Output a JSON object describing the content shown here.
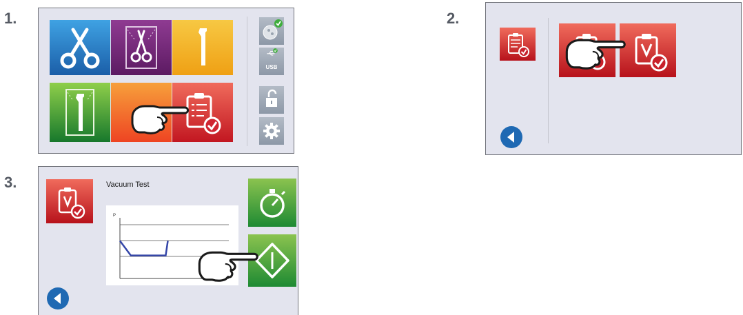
{
  "steps": {
    "step1": "1.",
    "step2": "2.",
    "step3": "3."
  },
  "screen1": {
    "tiles": [
      {
        "icon": "scissors-icon",
        "color": "#1b6fb8"
      },
      {
        "icon": "wrapped-forceps-icon",
        "color": "#7a2c7f"
      },
      {
        "icon": "handpiece-icon",
        "color": "#f1ad16"
      },
      {
        "icon": "wrapped-handpiece-icon",
        "color": "#3f9a3a"
      },
      {
        "icon": "orange-program-tile",
        "color": "#f05a28"
      },
      {
        "icon": "test-checklist-icon",
        "color": "#d7222d"
      }
    ],
    "side": {
      "sd_card_icon": "sd-card-check-icon",
      "usb_label": "USB",
      "lock_icon": "unlock-icon",
      "settings_icon": "gear-icon"
    }
  },
  "screen2": {
    "tests_icon": "test-checklist-icon",
    "options": [
      "bowie-dick-test-icon",
      "vacuum-test-icon"
    ]
  },
  "screen3": {
    "title": "Vacuum Test",
    "chart_ylabel": "P"
  },
  "colors": {
    "red_top": "#f06b5c",
    "red_bottom": "#b7121b",
    "green_top": "#8bc34f",
    "green_bottom": "#1e8a33",
    "back_button": "#1f69b3",
    "vacuum_curve": "#3446a8"
  },
  "chart_data": {
    "type": "line",
    "title": "",
    "xlabel": "",
    "ylabel": "P",
    "series": [
      {
        "x": [
          0,
          1,
          3,
          4.2,
          4.4
        ],
        "y": [
          0.62,
          0.38,
          0.38,
          0.38,
          0.62
        ]
      }
    ],
    "ylim": [
      0,
      1
    ],
    "grid": true
  }
}
